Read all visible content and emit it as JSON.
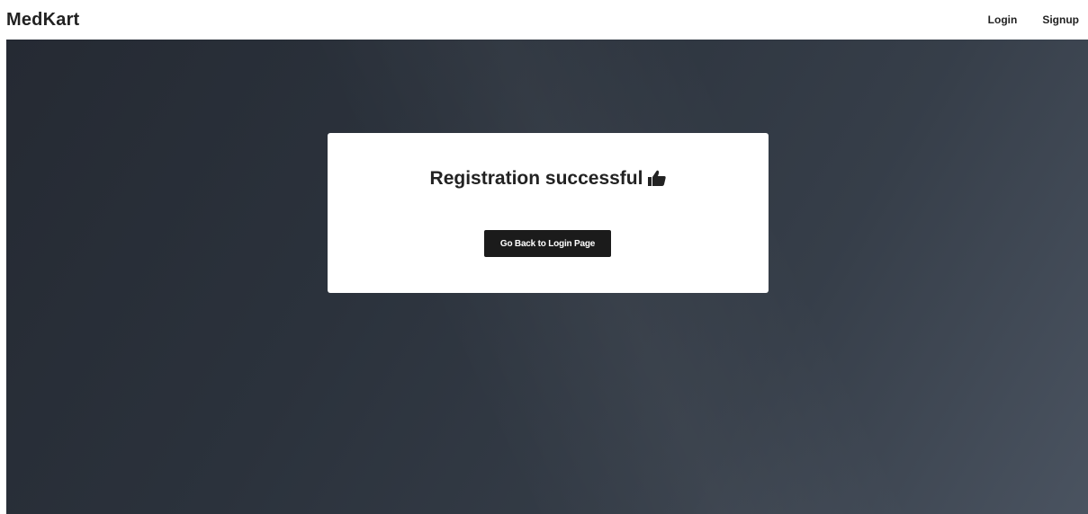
{
  "navbar": {
    "brand": "MedKart",
    "links": [
      "Login",
      "Signup"
    ]
  },
  "card": {
    "title": "Registration successful",
    "title_icon": "thumbs-up-icon",
    "button_label": "Go Back to Login Page"
  },
  "colors": {
    "background_dark": "#2b323c",
    "background_light": "#4a5360",
    "button": "#1b1b1b",
    "card": "#ffffff"
  }
}
